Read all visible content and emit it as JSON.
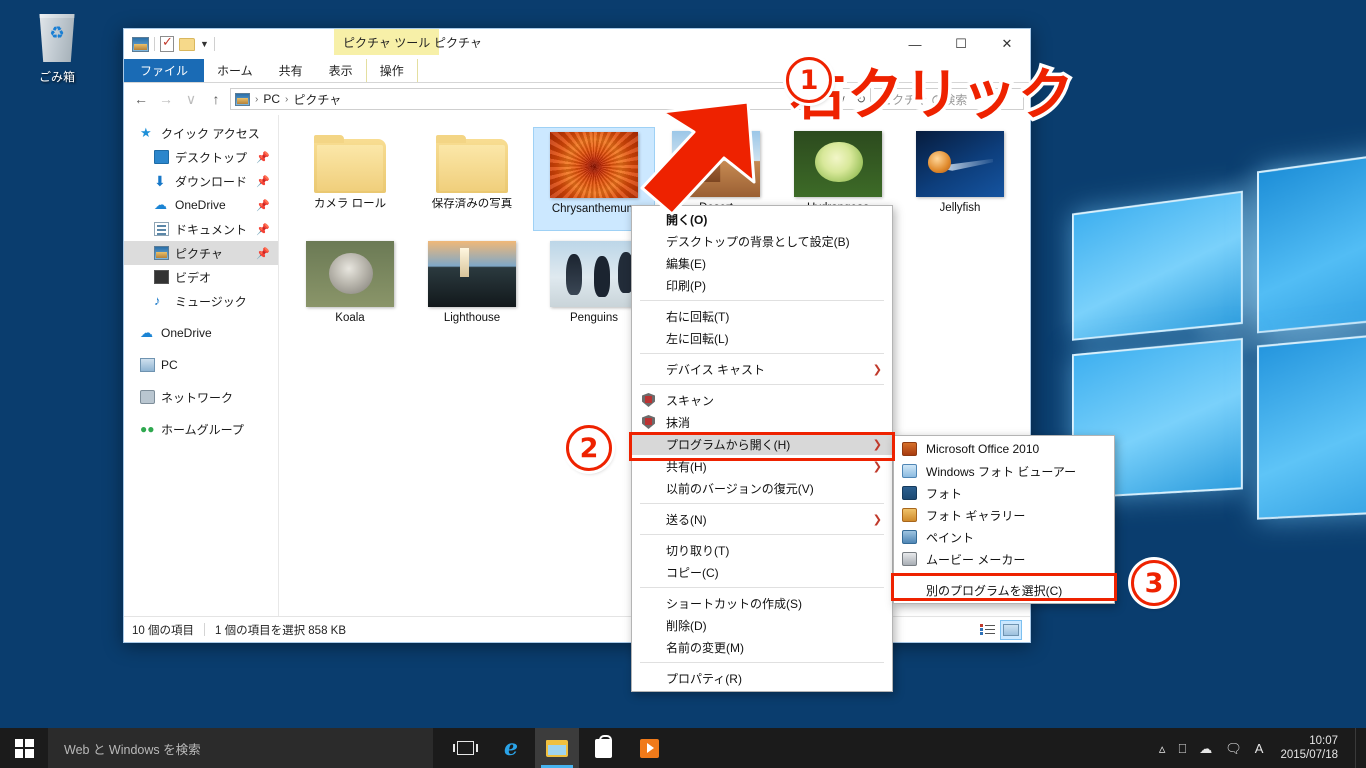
{
  "desktop": {
    "recycle_bin_label": "ごみ箱"
  },
  "explorer": {
    "quick_access_toolbar": [
      "pictures-icon",
      "properties-icon",
      "new-folder-icon",
      "customize-caret"
    ],
    "contextual_tab_group": "ピクチャ ツール",
    "window_title": "ピクチャ",
    "window_controls": {
      "minimize": "—",
      "maximize": "☐",
      "close": "✕"
    },
    "ribbon_tabs": [
      {
        "label": "ファイル",
        "active": true,
        "kind": "file"
      },
      {
        "label": "ホーム",
        "active": false,
        "kind": "normal"
      },
      {
        "label": "共有",
        "active": false,
        "kind": "normal"
      },
      {
        "label": "表示",
        "active": false,
        "kind": "normal"
      },
      {
        "label": "操作",
        "active": false,
        "kind": "contextual"
      }
    ],
    "address_bar": {
      "back": "←",
      "forward": "→",
      "recent": "∨",
      "up": "↑",
      "crumbs": [
        "PC",
        "ピクチャ"
      ],
      "separator": "›",
      "dropdown_caret": "∨",
      "refresh": "↻"
    },
    "search": {
      "placeholder": "ピクチャ の検索"
    },
    "nav_pane": [
      {
        "label": "クイック アクセス",
        "icon": "star-icon",
        "level": 1,
        "pinned": false,
        "selected": false
      },
      {
        "label": "デスクトップ",
        "icon": "desktop-icon",
        "level": 2,
        "pinned": true,
        "selected": false
      },
      {
        "label": "ダウンロード",
        "icon": "download-icon",
        "level": 2,
        "pinned": true,
        "selected": false
      },
      {
        "label": "OneDrive",
        "icon": "cloud-icon",
        "level": 2,
        "pinned": true,
        "selected": false
      },
      {
        "label": "ドキュメント",
        "icon": "document-icon",
        "level": 2,
        "pinned": true,
        "selected": false
      },
      {
        "label": "ピクチャ",
        "icon": "pictures-icon",
        "level": 2,
        "pinned": true,
        "selected": true
      },
      {
        "label": "ビデオ",
        "icon": "video-icon",
        "level": 2,
        "pinned": false,
        "selected": false
      },
      {
        "label": "ミュージック",
        "icon": "music-icon",
        "level": 2,
        "pinned": false,
        "selected": false
      },
      {
        "label": "OneDrive",
        "icon": "cloud-icon",
        "level": 1,
        "pinned": false,
        "selected": false,
        "gap_before": true
      },
      {
        "label": "PC",
        "icon": "pc-icon",
        "level": 1,
        "pinned": false,
        "selected": false,
        "gap_before": true
      },
      {
        "label": "ネットワーク",
        "icon": "network-icon",
        "level": 1,
        "pinned": false,
        "selected": false,
        "gap_before": true
      },
      {
        "label": "ホームグループ",
        "icon": "homegroup-icon",
        "level": 1,
        "pinned": false,
        "selected": false,
        "gap_before": true
      }
    ],
    "items": [
      {
        "name": "カメラ ロール",
        "type": "folder",
        "selected": false
      },
      {
        "name": "保存済みの写真",
        "type": "folder",
        "selected": false
      },
      {
        "name": "Chrysanthemum",
        "type": "image",
        "art": "t-chrys",
        "selected": true
      },
      {
        "name": "Desert",
        "type": "image",
        "art": "t-desert",
        "selected": false
      },
      {
        "name": "Hydrangeas",
        "type": "image",
        "art": "t-hydr",
        "selected": false
      },
      {
        "name": "Jellyfish",
        "type": "image",
        "art": "t-jelly",
        "selected": false
      },
      {
        "name": "Koala",
        "type": "image",
        "art": "t-koala",
        "selected": false
      },
      {
        "name": "Lighthouse",
        "type": "image",
        "art": "t-light",
        "selected": false
      },
      {
        "name": "Penguins",
        "type": "image",
        "art": "t-peng",
        "selected": false
      }
    ],
    "status_bar": {
      "item_count": "10 個の項目",
      "selection": "1 個の項目を選択  858 KB",
      "view_list": "list-view-icon",
      "view_large": "large-icons-view-icon"
    }
  },
  "context_menu": [
    {
      "label": "開く(O)",
      "bold": true,
      "submenu": false,
      "shield": false
    },
    {
      "label": "デスクトップの背景として設定(B)",
      "bold": false,
      "submenu": false,
      "shield": false
    },
    {
      "label": "編集(E)",
      "bold": false,
      "submenu": false,
      "shield": false
    },
    {
      "label": "印刷(P)",
      "bold": false,
      "submenu": false,
      "shield": false
    },
    {
      "separator": true
    },
    {
      "label": "右に回転(T)",
      "bold": false,
      "submenu": false,
      "shield": false
    },
    {
      "label": "左に回転(L)",
      "bold": false,
      "submenu": false,
      "shield": false
    },
    {
      "separator": true
    },
    {
      "label": "デバイス キャスト",
      "bold": false,
      "submenu": true,
      "shield": false
    },
    {
      "separator": true
    },
    {
      "label": "スキャン",
      "bold": false,
      "submenu": false,
      "shield": true
    },
    {
      "label": "抹消",
      "bold": false,
      "submenu": false,
      "shield": true
    },
    {
      "label": "プログラムから開く(H)",
      "bold": false,
      "submenu": true,
      "shield": false,
      "highlighted": true
    },
    {
      "label": "共有(H)",
      "bold": false,
      "submenu": true,
      "shield": false
    },
    {
      "label": "以前のバージョンの復元(V)",
      "bold": false,
      "submenu": false,
      "shield": false
    },
    {
      "separator": true
    },
    {
      "label": "送る(N)",
      "bold": false,
      "submenu": true,
      "shield": false
    },
    {
      "separator": true
    },
    {
      "label": "切り取り(T)",
      "bold": false,
      "submenu": false,
      "shield": false
    },
    {
      "label": "コピー(C)",
      "bold": false,
      "submenu": false,
      "shield": false
    },
    {
      "separator": true
    },
    {
      "label": "ショートカットの作成(S)",
      "bold": false,
      "submenu": false,
      "shield": false
    },
    {
      "label": "削除(D)",
      "bold": false,
      "submenu": false,
      "shield": false
    },
    {
      "label": "名前の変更(M)",
      "bold": false,
      "submenu": false,
      "shield": false
    },
    {
      "separator": true
    },
    {
      "label": "プロパティ(R)",
      "bold": false,
      "submenu": false,
      "shield": false
    }
  ],
  "open_with_submenu": [
    {
      "label": "Microsoft Office 2010",
      "icon": "office-icon",
      "icon_class": "ai-office"
    },
    {
      "label": "Windows フォト ビューアー",
      "icon": "photo-viewer-icon",
      "icon_class": "ai-wpv"
    },
    {
      "label": "フォト",
      "icon": "photos-icon",
      "icon_class": "ai-photo"
    },
    {
      "label": "フォト ギャラリー",
      "icon": "photo-gallery-icon",
      "icon_class": "ai-gal"
    },
    {
      "label": "ペイント",
      "icon": "paint-icon",
      "icon_class": "ai-paint"
    },
    {
      "label": "ムービー メーカー",
      "icon": "movie-maker-icon",
      "icon_class": "ai-movie"
    },
    {
      "separator": true
    },
    {
      "label": "別のプログラムを選択(C)",
      "icon": null,
      "icon_class": "",
      "no_icon": true
    }
  ],
  "annotations": {
    "step1_number": "①",
    "step1_text": "右クリック",
    "step2_number": "②",
    "step3_number": "③",
    "accent_color": "#ee2200"
  },
  "taskbar": {
    "start": "windows-logo-icon",
    "search_placeholder": "Web と Windows を検索",
    "buttons": [
      {
        "name": "task-view-icon"
      },
      {
        "name": "edge-icon"
      },
      {
        "name": "file-explorer-icon",
        "active": true
      },
      {
        "name": "store-icon"
      },
      {
        "name": "media-player-icon"
      }
    ],
    "tray": [
      {
        "name": "show-hidden-icons-chevron",
        "glyph": "∧"
      },
      {
        "name": "network-icon",
        "glyph": "⎕"
      },
      {
        "name": "onedrive-icon",
        "glyph": "☁"
      },
      {
        "name": "action-center-icon",
        "glyph": "὞8"
      },
      {
        "name": "ime-icon",
        "glyph": "A"
      }
    ],
    "clock_time": "10:07",
    "clock_date": "2015/07/18"
  }
}
